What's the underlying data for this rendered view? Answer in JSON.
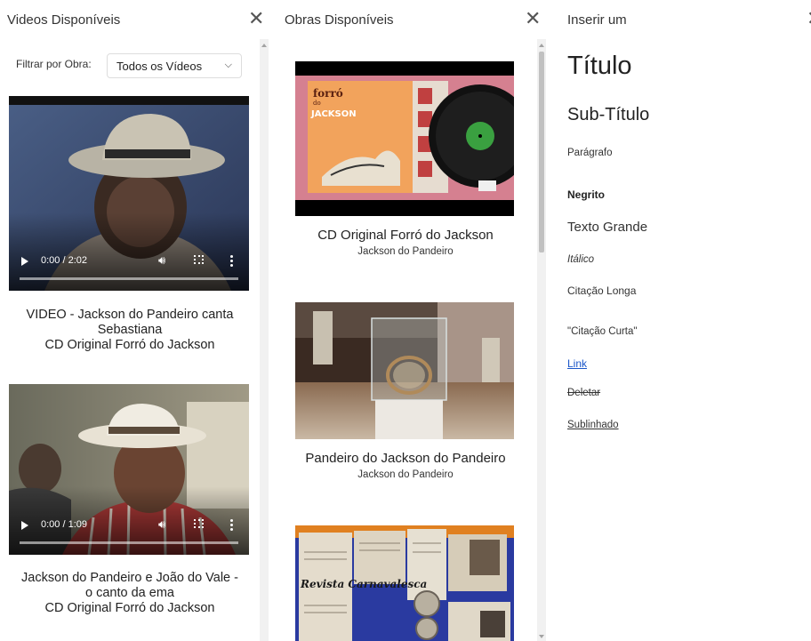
{
  "videos_panel": {
    "title": "Videos Disponíveis",
    "close_icon": "close-icon",
    "filter": {
      "label": "Filtrar por Obra:",
      "selected": "Todos os Vídeos"
    },
    "videos": [
      {
        "time": "0:00 / 2:02",
        "title_line1": "VIDEO - Jackson do Pandeiro canta",
        "title_line2": "Sebastiana",
        "obra": "CD Original Forró do Jackson"
      },
      {
        "time": "0:00 / 1:09",
        "title_line1": "Jackson do Pandeiro e João do Vale -",
        "title_line2": "o canto da ema",
        "obra": "CD Original Forró do Jackson"
      }
    ]
  },
  "obras_panel": {
    "title": "Obras Disponíveis",
    "close_icon": "close-icon",
    "items": [
      {
        "name": "CD Original Forró do Jackson",
        "author": "Jackson do Pandeiro",
        "album_text_1": "forró",
        "album_text_2": "do",
        "album_text_3": "JACKSON"
      },
      {
        "name": "Pandeiro do Jackson do Pandeiro",
        "author": "Jackson do Pandeiro"
      },
      {
        "name": "",
        "author": "",
        "poster_text": "Revista Carnavalesca"
      }
    ]
  },
  "inserir_panel": {
    "title": "Inserir um",
    "close_icon": "close-icon",
    "options": {
      "titulo": "Título",
      "subtitulo": "Sub-Título",
      "paragrafo": "Parágrafo",
      "negrito": "Negrito",
      "texto_grande": "Texto Grande",
      "italico": "Itálico",
      "citacao_longa": "Citação Longa",
      "citacao_curta": "\"Citação Curta\"",
      "link": "Link",
      "deletar": "Deletar",
      "sublinhado": "Sublinhado"
    }
  },
  "colors": {
    "link": "#1a56c9",
    "panel_bg": "#ffffff",
    "scrollbar_thumb": "#c1c1c1"
  }
}
